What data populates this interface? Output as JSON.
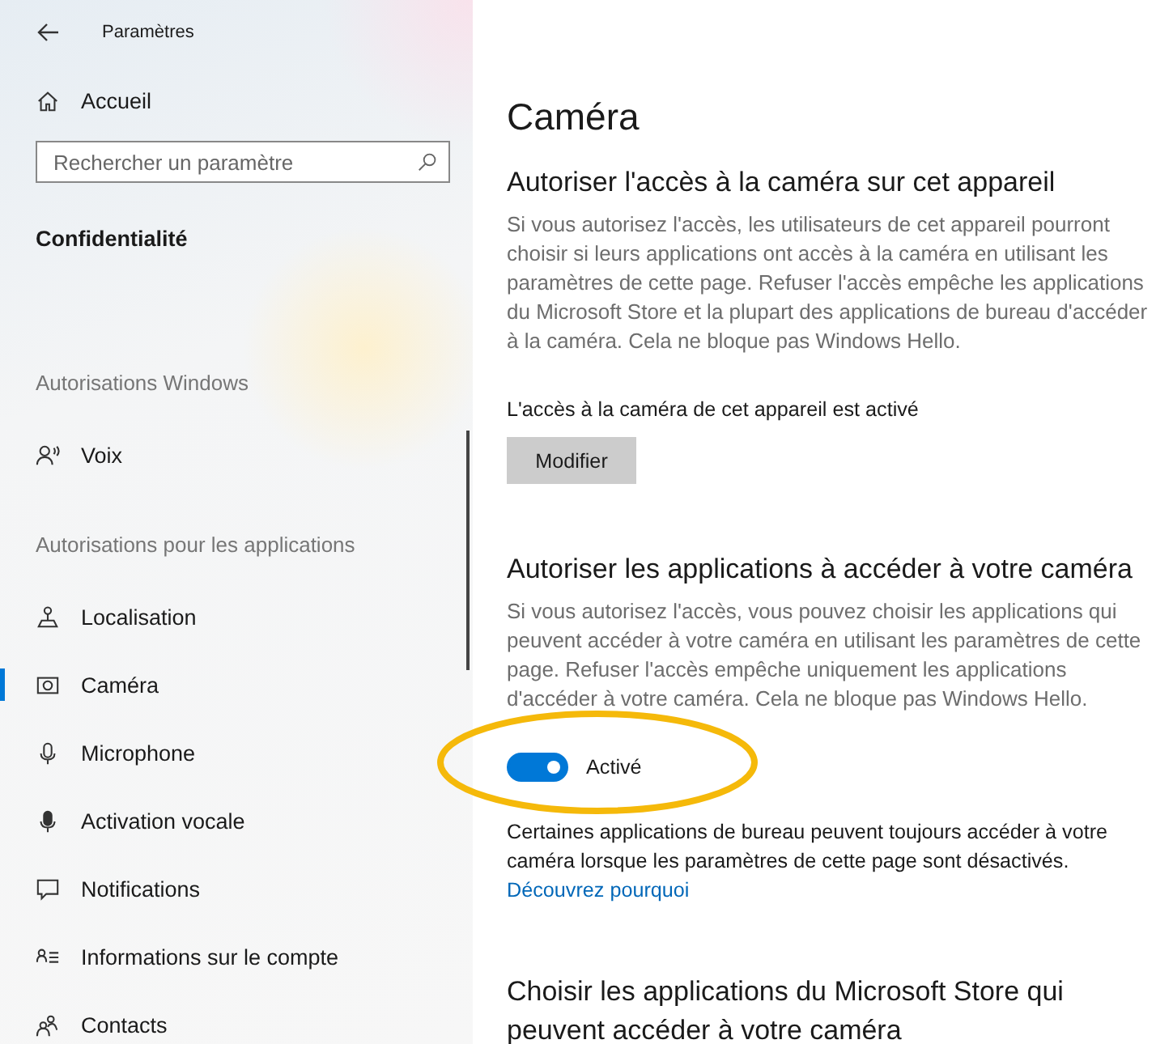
{
  "window": {
    "title": "Paramètres"
  },
  "sidebar": {
    "home": "Accueil",
    "search": {
      "placeholder": "Rechercher un paramètre"
    },
    "section": "Confidentialité",
    "groups": [
      {
        "heading": "Autorisations Windows",
        "items": [
          {
            "label": "Voix",
            "selected": false
          }
        ]
      },
      {
        "heading": "Autorisations pour les applications",
        "items": [
          {
            "label": "Localisation",
            "selected": false
          },
          {
            "label": "Caméra",
            "selected": true
          },
          {
            "label": "Microphone",
            "selected": false
          },
          {
            "label": "Activation vocale",
            "selected": false
          },
          {
            "label": "Notifications",
            "selected": false
          },
          {
            "label": "Informations sur le compte",
            "selected": false
          },
          {
            "label": "Contacts",
            "selected": false
          }
        ]
      }
    ]
  },
  "page": {
    "title": "Caméra",
    "device": {
      "heading": "Autoriser l'accès à la caméra sur cet appareil",
      "text": "Si vous autorisez l'accès, les utilisateurs de cet appareil pourront choisir si leurs applications ont accès à la caméra en utilisant les paramètres de cette page. Refuser l'accès empêche les applications du Microsoft Store et la plupart des applications de bureau d'accéder à la caméra. Cela ne bloque pas Windows Hello.",
      "status": "L'accès à la caméra de cet appareil est activé",
      "button": "Modifier"
    },
    "apps": {
      "heading": "Autoriser les applications à accéder à votre caméra",
      "text": "Si vous autorisez l'accès, vous pouvez choisir les applications qui peuvent accéder à votre caméra en utilisant les paramètres de cette page. Refuser l'accès empêche uniquement les applications d'accéder à votre caméra. Cela ne bloque pas Windows Hello.",
      "toggle": {
        "on": true,
        "label": "Activé"
      },
      "note": "Certaines applications de bureau peuvent toujours accéder à votre caméra lorsque les paramètres de cette page sont désactivés.",
      "link": "Découvrez pourquoi"
    },
    "store": {
      "heading": "Choisir les applications du Microsoft Store qui peuvent accéder à votre caméra"
    }
  }
}
